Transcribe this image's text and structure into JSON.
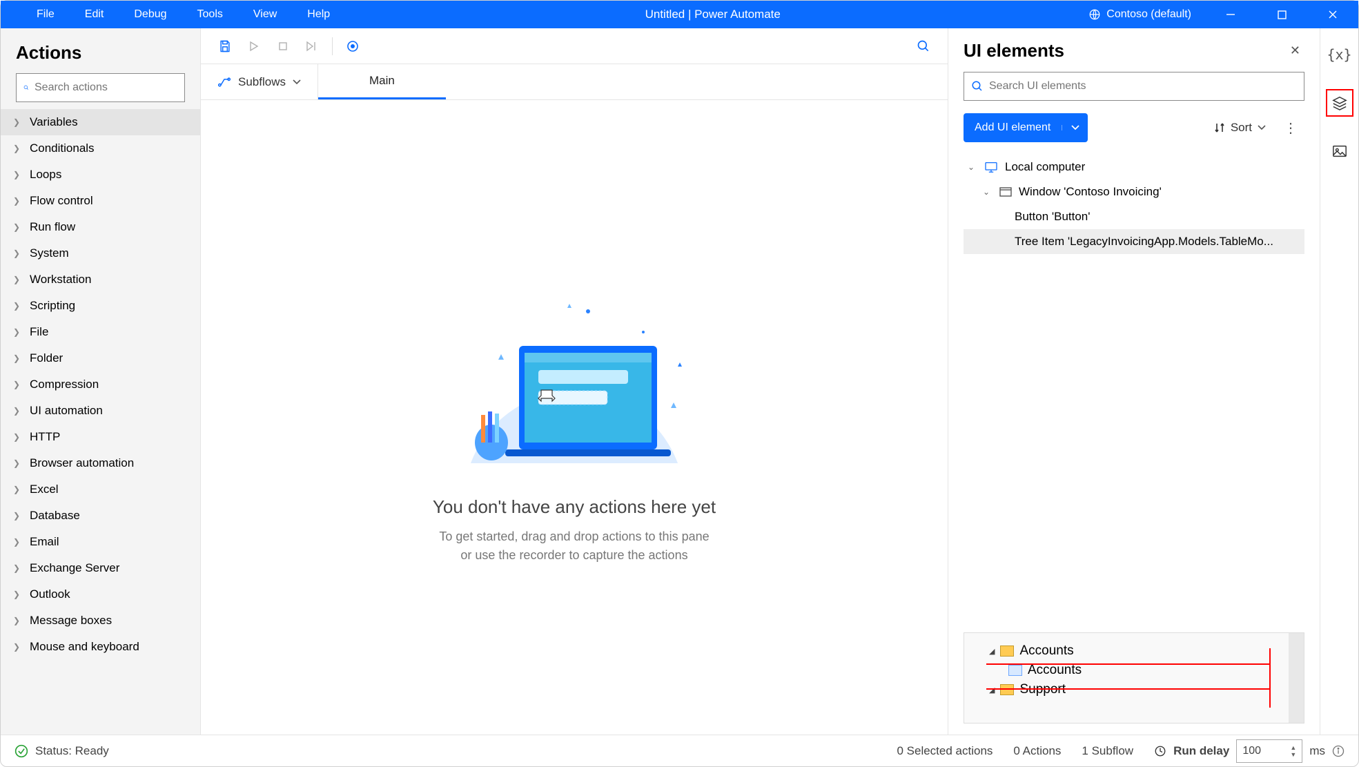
{
  "titlebar": {
    "menus": [
      "File",
      "Edit",
      "Debug",
      "Tools",
      "View",
      "Help"
    ],
    "title": "Untitled | Power Automate",
    "environment": "Contoso (default)"
  },
  "actions_panel": {
    "heading": "Actions",
    "search_placeholder": "Search actions",
    "items": [
      "Variables",
      "Conditionals",
      "Loops",
      "Flow control",
      "Run flow",
      "System",
      "Workstation",
      "Scripting",
      "File",
      "Folder",
      "Compression",
      "UI automation",
      "HTTP",
      "Browser automation",
      "Excel",
      "Database",
      "Email",
      "Exchange Server",
      "Outlook",
      "Message boxes",
      "Mouse and keyboard"
    ]
  },
  "tabs": {
    "subflows": "Subflows",
    "main": "Main"
  },
  "canvas": {
    "heading": "You don't have any actions here yet",
    "line1": "To get started, drag and drop actions to this pane",
    "line2": "or use the recorder to capture the actions"
  },
  "ui_panel": {
    "heading": "UI elements",
    "search_placeholder": "Search UI elements",
    "add_button": "Add UI element",
    "sort": "Sort",
    "tree": {
      "root": "Local computer",
      "window": "Window 'Contoso Invoicing'",
      "item1": "Button 'Button'",
      "item2": "Tree Item 'LegacyInvoicingApp.Models.TableMo..."
    },
    "preview": {
      "r1": "Accounts",
      "r2": "Accounts",
      "r3": "Support"
    }
  },
  "status": {
    "ready": "Status: Ready",
    "selected": "0 Selected actions",
    "actions": "0 Actions",
    "subflow": "1 Subflow",
    "run_delay_label": "Run delay",
    "run_delay_value": "100",
    "ms": "ms"
  }
}
